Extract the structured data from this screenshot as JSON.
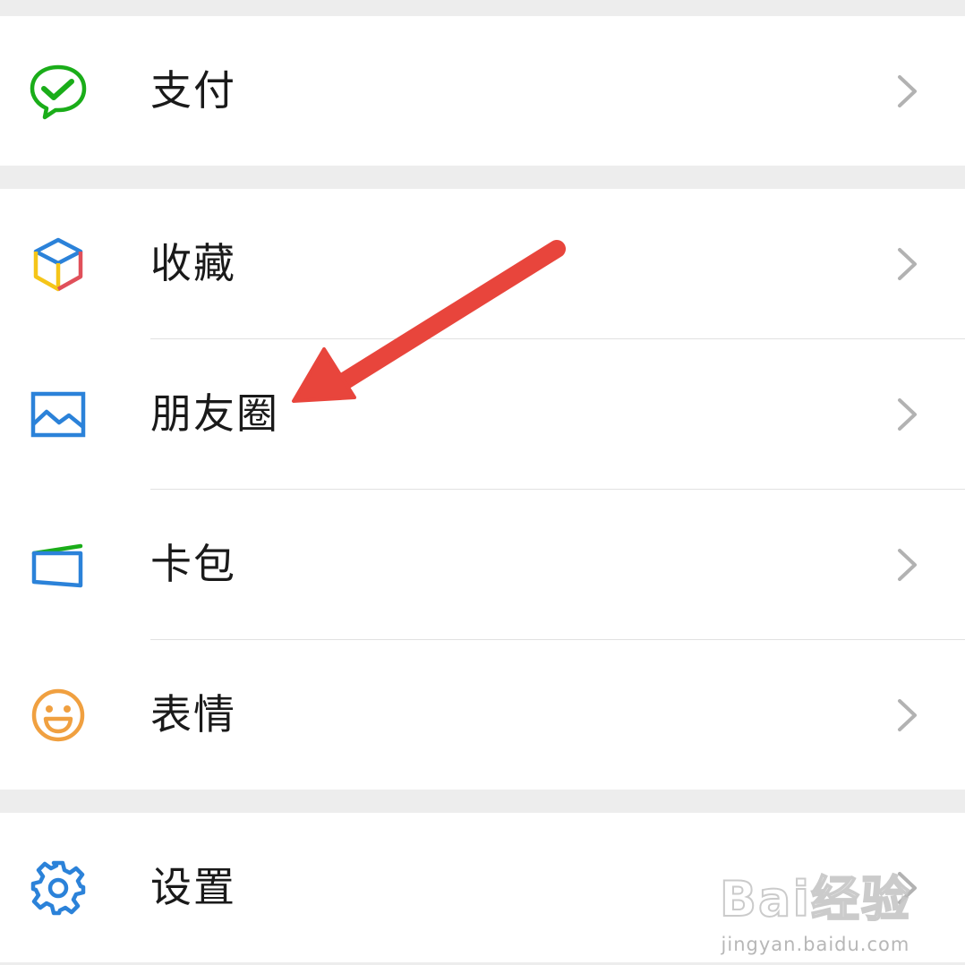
{
  "menu": {
    "pay": {
      "label": "支付",
      "icon": "wechat-pay-icon",
      "color": "#1aad19"
    },
    "favorites": {
      "label": "收藏",
      "icon": "favorites-cube-icon"
    },
    "moments": {
      "label": "朋友圈",
      "icon": "moments-picture-icon",
      "color": "#2b82d9"
    },
    "cards": {
      "label": "卡包",
      "icon": "card-wallet-icon",
      "color": "#2b82d9"
    },
    "stickers": {
      "label": "表情",
      "icon": "sticker-smile-icon",
      "color": "#f0a040"
    },
    "settings": {
      "label": "设置",
      "icon": "settings-gear-icon",
      "color": "#2b82d9"
    }
  },
  "annotation": {
    "color": "#e8453c"
  },
  "watermark": {
    "logo": "Bai经验",
    "url": "jingyan.baidu.com"
  }
}
